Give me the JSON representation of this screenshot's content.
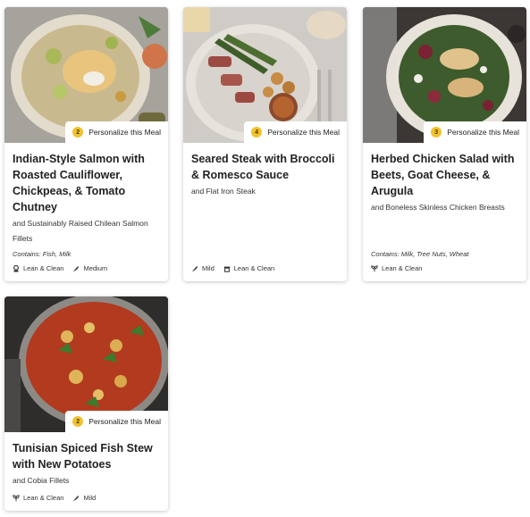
{
  "personalize_label": "Personalize this Meal",
  "meals": [
    {
      "badge_count": "2",
      "title": "Indian-Style Salmon with Roasted Cauliflower, Chickpeas, & Tomato Chutney",
      "subtitle": "and Sustainably Raised Chilean Salmon Fillets",
      "contains": "Contains: Fish, Milk",
      "tags": [
        {
          "icon": "lean-clean-icon",
          "label": "Lean & Clean"
        },
        {
          "icon": "chili-pepper-icon",
          "label": "Medium"
        }
      ]
    },
    {
      "badge_count": "4",
      "title": "Seared Steak with Broccoli & Romesco Sauce",
      "subtitle": "and Flat Iron Steak",
      "contains": "",
      "tags": [
        {
          "icon": "chili-pepper-icon",
          "label": "Mild"
        },
        {
          "icon": "lean-clean-icon",
          "label": "Lean & Clean"
        }
      ]
    },
    {
      "badge_count": "3",
      "title": "Herbed Chicken Salad with Beets, Goat Cheese, & Arugula",
      "subtitle": "and Boneless Skinless Chicken Breasts",
      "contains": "Contains: Milk, Tree Nuts, Wheat",
      "tags": [
        {
          "icon": "leaf-sprout-icon",
          "label": "Lean & Clean"
        }
      ]
    },
    {
      "badge_count": "2",
      "title": "Tunisian Spiced Fish Stew with New Potatoes",
      "subtitle": "and Cobia Fillets",
      "contains": "",
      "tags": [
        {
          "icon": "leaf-sprout-icon",
          "label": "Lean & Clean"
        },
        {
          "icon": "chili-pepper-icon",
          "label": "Mild"
        }
      ]
    }
  ]
}
